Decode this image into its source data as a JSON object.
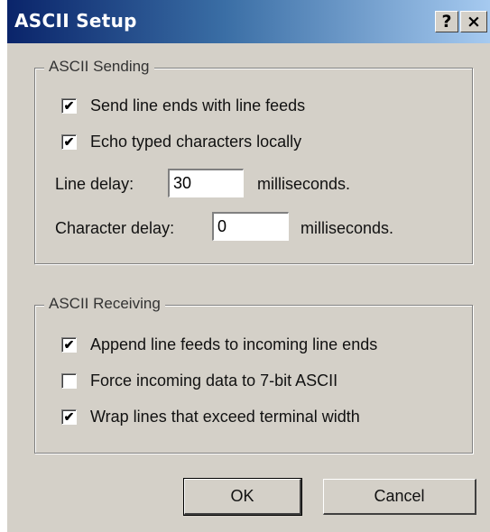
{
  "window": {
    "title": "ASCII Setup",
    "help_label": "?",
    "close_label": "×"
  },
  "sending": {
    "legend": "ASCII Sending",
    "send_line_ends": {
      "label": "Send line ends with line feeds",
      "checked": true
    },
    "echo_typed": {
      "label": "Echo typed characters locally",
      "checked": true
    },
    "line_delay": {
      "label": "Line delay:",
      "value": "30",
      "unit": "milliseconds."
    },
    "char_delay": {
      "label": "Character delay:",
      "value": "0",
      "unit": "milliseconds."
    }
  },
  "receiving": {
    "legend": "ASCII Receiving",
    "append_line_feeds": {
      "label": "Append line feeds to incoming line ends",
      "checked": true
    },
    "force_7bit": {
      "label": "Force incoming data to 7-bit ASCII",
      "checked": false
    },
    "wrap_lines": {
      "label": "Wrap lines that exceed terminal width",
      "checked": true
    }
  },
  "buttons": {
    "ok": "OK",
    "cancel": "Cancel"
  }
}
